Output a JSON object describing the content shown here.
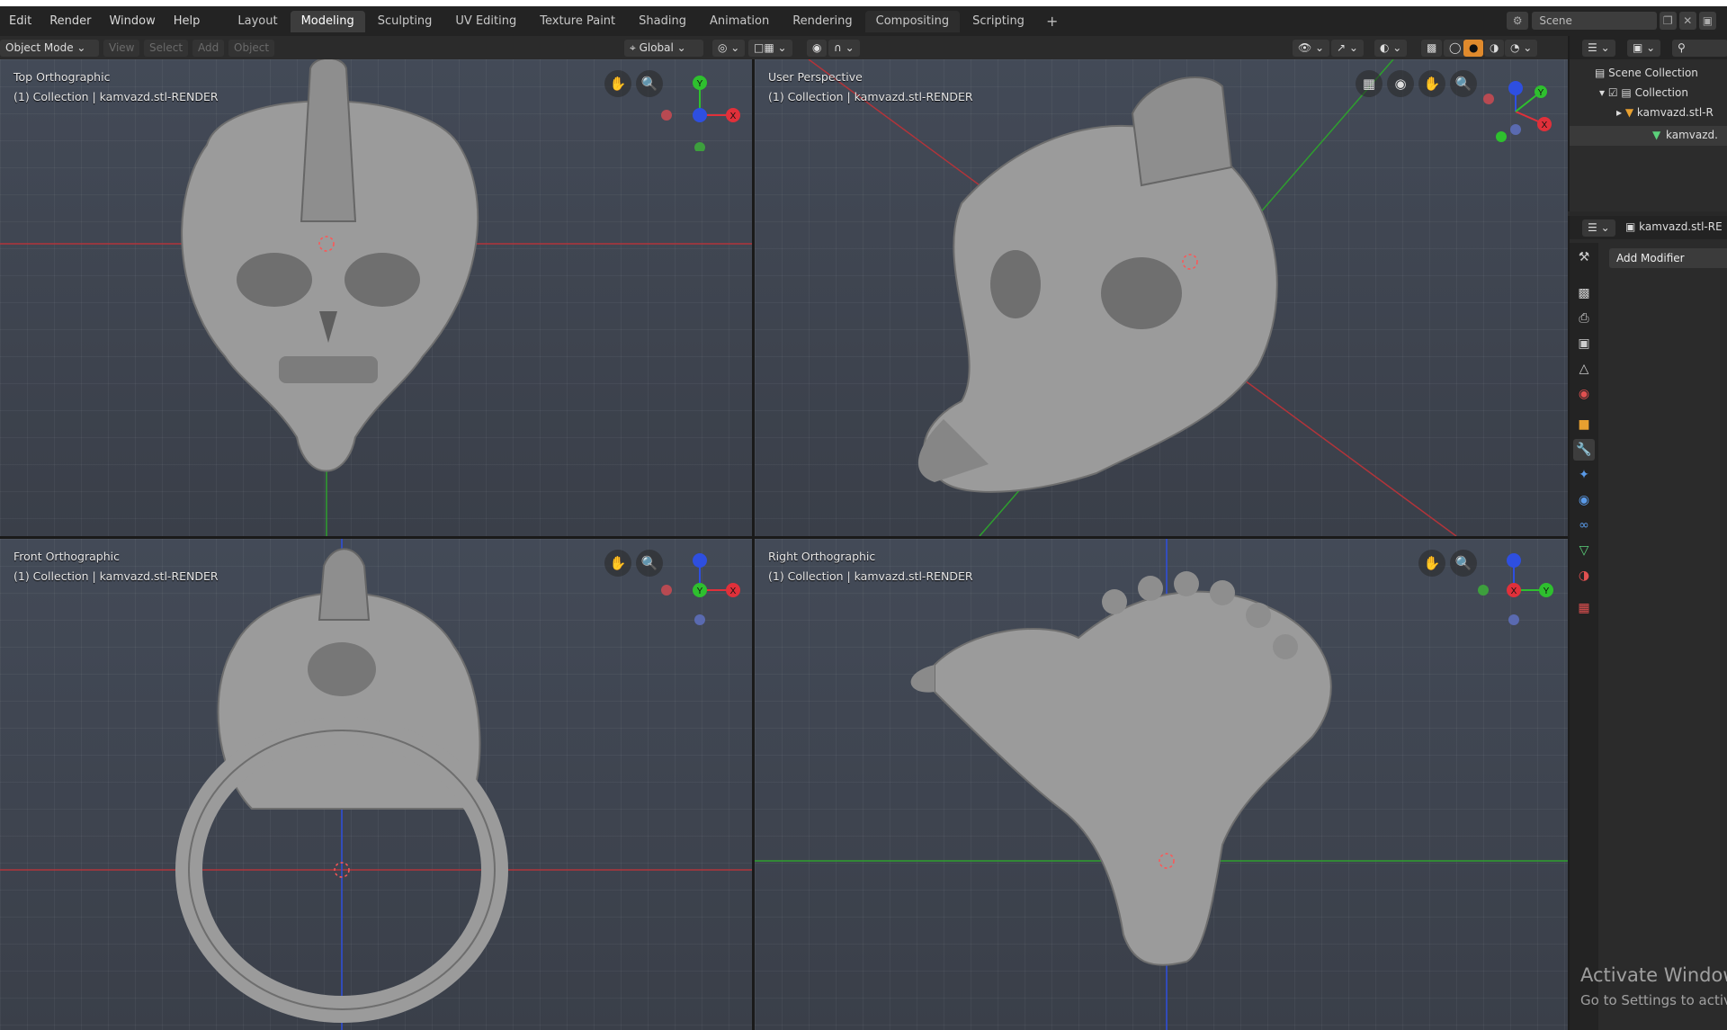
{
  "menu": [
    "Edit",
    "Render",
    "Window",
    "Help"
  ],
  "workspaces": [
    "Layout",
    "Modeling",
    "Sculpting",
    "UV Editing",
    "Texture Paint",
    "Shading",
    "Animation",
    "Rendering",
    "Compositing",
    "Scripting"
  ],
  "workspace_active": "Modeling",
  "workspace_add": "+",
  "scene": {
    "label": "Scene"
  },
  "header": {
    "mode": "Object Mode",
    "view": "View",
    "select": "Select",
    "add": "Add",
    "object": "Object",
    "orientation": "Global"
  },
  "viewports": [
    {
      "title": "Top Orthographic",
      "subtitle": "(1) Collection | kamvazd.stl-RENDER"
    },
    {
      "title": "User Perspective",
      "subtitle": "(1) Collection | kamvazd.stl-RENDER"
    },
    {
      "title": "Front Orthographic",
      "subtitle": "(1) Collection | kamvazd.stl-RENDER"
    },
    {
      "title": "Right Orthographic",
      "subtitle": "(1) Collection | kamvazd.stl-RENDER"
    }
  ],
  "gizmo_axes": {
    "x": "X",
    "y": "Y",
    "z": "Z"
  },
  "colors": {
    "x_axis": "#e0303a",
    "y_axis": "#2ec02e",
    "z_axis": "#2e4fe0",
    "viewport_bg": "#434a57",
    "model": "#9a9a9a"
  },
  "outliner": {
    "root": "Scene Collection",
    "collection": "Collection",
    "object": "kamvazd.stl-R",
    "mesh": "kamvazd."
  },
  "properties": {
    "object_name": "kamvazd.stl-RE",
    "add_modifier": "Add Modifier"
  },
  "watermark": {
    "line1": "Activate Windows",
    "line2": "Go to Settings to activ"
  }
}
